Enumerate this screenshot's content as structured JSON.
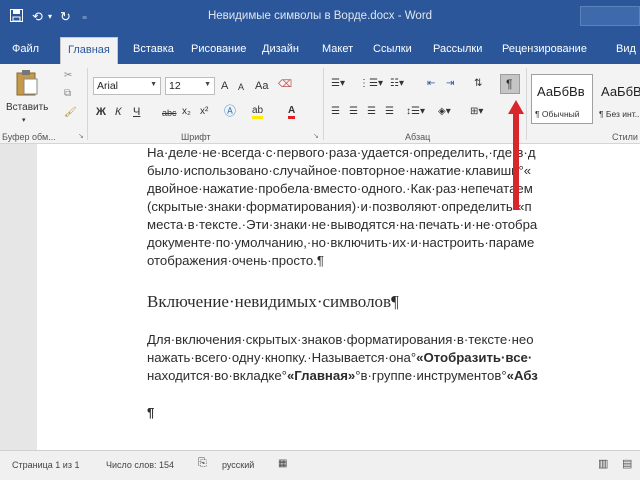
{
  "titlebar": {
    "document_title": "Невидимые символы в Ворде.docx  -  Word",
    "save_icon": "floppy-save-icon",
    "undo_icon": "undo-icon",
    "redo_icon": "redo-icon",
    "customize_icon": "customize-quick-access-icon"
  },
  "tabs": [
    "Файл",
    "Главная",
    "Вставка",
    "Рисование",
    "Дизайн",
    "Макет",
    "Ссылки",
    "Рассылки",
    "Рецензирование",
    "Вид"
  ],
  "ribbon": {
    "clipboard": {
      "paste_label": "Вставить",
      "group_label": "Буфер обм..."
    },
    "font": {
      "font_name": "Arial",
      "font_size": "12",
      "grow_label": "A",
      "shrink_label": "A",
      "case_label": "Aa",
      "bold": "Ж",
      "italic": "К",
      "underline": "Ч",
      "strike": "abc",
      "subscript": "x₂",
      "superscript": "x²",
      "group_label": "Шрифт"
    },
    "paragraph": {
      "group_label": "Абзац",
      "pilcrow": "¶"
    },
    "styles": {
      "group_label": "Стили",
      "items": [
        {
          "sample": "АаБбВв",
          "name": "¶ Обычный"
        },
        {
          "sample": "АаБбВ",
          "name": "¶ Без инт..."
        }
      ]
    }
  },
  "document": {
    "para1": [
      "На·деле·не·всегда·с·первого·раза·удается·определить,·где·в·д",
      "было·использовано·случайное·повторное·нажатие·клавиши°«",
      "двойное·нажатие·пробела·вместо·одного.·Как·раз·непечатаем",
      "(скрытые·знаки·форматирования)·и·позволяют·определить·«п",
      "места·в·тексте.·Эти·знаки·не·выводятся·на·печать·и·не·отобра",
      "документе·по·умолчанию,·но·включить·их·и·настроить·параме",
      "отображения·очень·просто.¶"
    ],
    "heading": "Включение·невидимых·символов¶",
    "para2": [
      {
        "pre": "Для·включения·скрытых·знаков·форматирования·в·тексте·нео",
        "bold": "",
        "post": ""
      },
      {
        "pre": "нажать·всего·одну·кнопку.·Называется·она°",
        "bold": "«Отобразить·все·",
        "post": ""
      },
      {
        "pre": "находится·во·вкладке°",
        "bold": "«Главная»",
        "post": "°в·группе·инструментов°",
        "bold2": "«Абз"
      }
    ],
    "empty_para": "¶"
  },
  "statusbar": {
    "page": "Страница 1 из 1",
    "words": "Число слов: 154",
    "language": "русский"
  },
  "colors": {
    "accent": "#2b579a",
    "arrow": "#d9262c"
  }
}
